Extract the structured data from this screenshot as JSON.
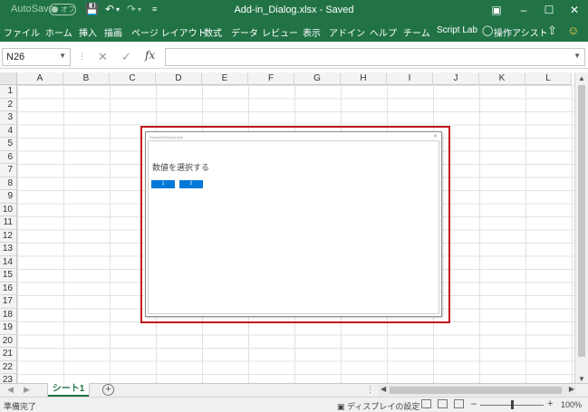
{
  "titlebar": {
    "autosave_label": "AutoSave",
    "autosave_state": "オフ",
    "document_title": "Add-in_Dialog.xlsx - Saved"
  },
  "ribbon": {
    "tabs": [
      "ファイル",
      "ホーム",
      "挿入",
      "描画",
      "ページ レイアウト",
      "数式",
      "データ",
      "レビュー",
      "表示",
      "アドイン",
      "ヘルプ",
      "チーム",
      "Script Lab"
    ],
    "assist_label": "操作アシスト"
  },
  "formula_bar": {
    "name_box": "N26",
    "formula": ""
  },
  "grid": {
    "columns": [
      "A",
      "B",
      "C",
      "D",
      "E",
      "F",
      "G",
      "H",
      "I",
      "J",
      "K",
      "L"
    ],
    "rows": [
      "1",
      "2",
      "3",
      "4",
      "5",
      "6",
      "7",
      "8",
      "9",
      "10",
      "11",
      "12",
      "13",
      "14",
      "15",
      "16",
      "17",
      "18",
      "19",
      "20",
      "21",
      "22",
      "23"
    ]
  },
  "sheets": {
    "active": "シート1"
  },
  "status": {
    "ready": "準備完了",
    "display_settings": "ディスプレイの設定",
    "zoom": "100%"
  },
  "dialog": {
    "title": "SimpleDialogSample",
    "prompt": "数値を選択する",
    "buttons": [
      "1",
      "2"
    ]
  },
  "icons": {
    "save": "save-icon",
    "undo": "undo-icon",
    "redo": "redo-icon",
    "lightbulb": "lightbulb-icon",
    "share": "share-icon",
    "smiley": "smiley-icon"
  },
  "colors": {
    "excel_green": "#217346",
    "dialog_button": "#0078d7",
    "highlight_border": "#c0151b"
  }
}
